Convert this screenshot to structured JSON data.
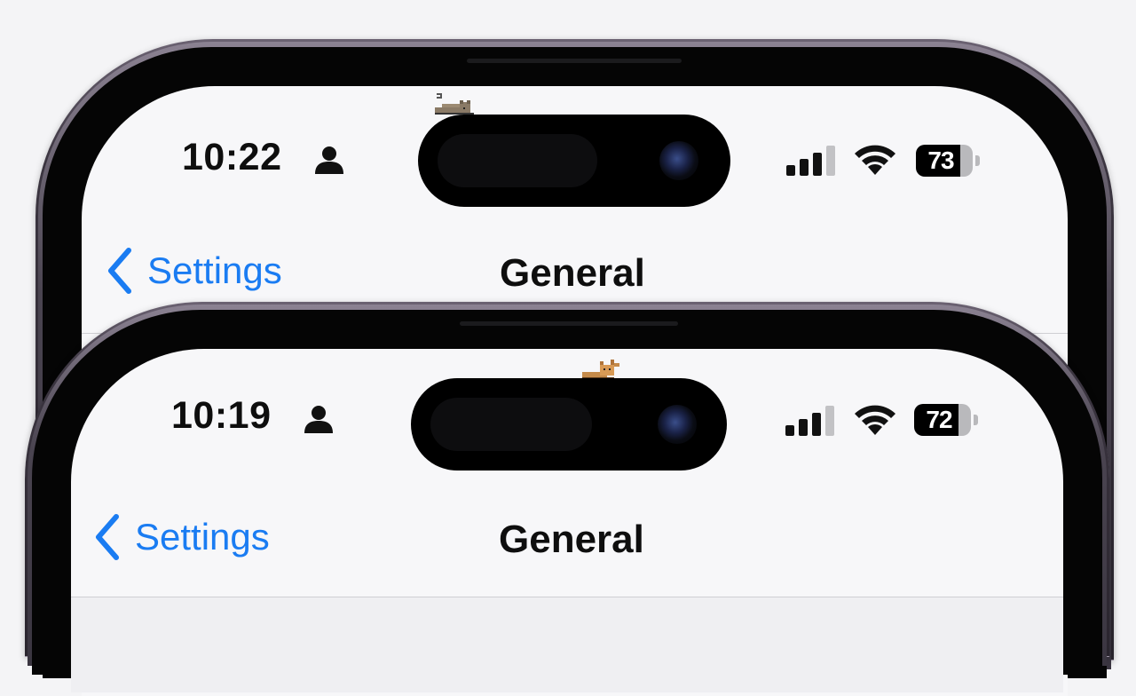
{
  "phones": [
    {
      "status_bar": {
        "time": "10:22",
        "battery_percent": "73"
      },
      "nav": {
        "back_label": "Settings",
        "title": "General"
      }
    },
    {
      "status_bar": {
        "time": "10:19",
        "battery_percent": "72"
      },
      "nav": {
        "back_label": "Settings",
        "title": "General"
      }
    }
  ],
  "colors": {
    "accent": "#1a7cf2",
    "frame": "#3b3540",
    "screen_bg": "#f7f7f9"
  },
  "icons": [
    "person-icon",
    "cellular-signal-icon",
    "wifi-icon",
    "battery-icon",
    "chevron-left-icon",
    "pixel-cat-icon",
    "front-camera-icon"
  ]
}
